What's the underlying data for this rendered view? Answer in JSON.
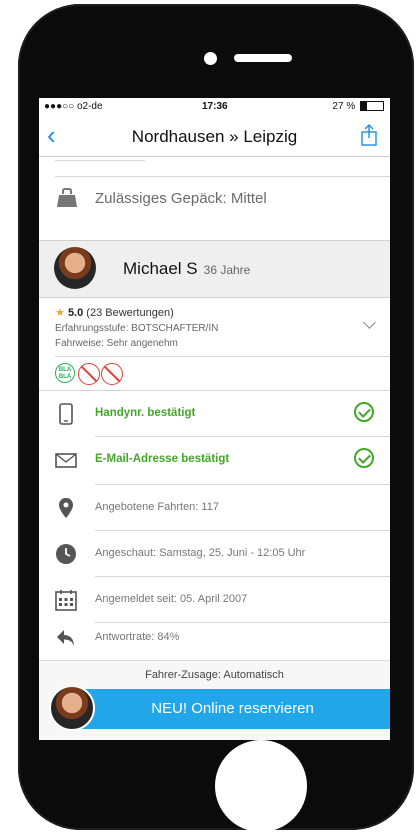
{
  "status_bar": {
    "carrier": "●●●○○ o2-de",
    "time": "17:36",
    "battery": "27 %"
  },
  "nav": {
    "title": "Nordhausen » Leipzig",
    "back_icon": "chevron-left-icon",
    "share_icon": "share-icon"
  },
  "luggage": {
    "label": "Zulässiges Gepäck: Mittel"
  },
  "driver": {
    "name": "Michael S",
    "age": "36 Jahre",
    "rating_score": "5.0",
    "rating_count": "(23 Bewertungen)",
    "experience": "Erfahrungsstufe: BOTSCHAFTER/IN",
    "driving_style": "Fahrweise: Sehr angenehm",
    "prefs_badge": "BLA BLA"
  },
  "verifications": [
    {
      "label": "Handynr. bestätigt",
      "icon": "phone-icon"
    },
    {
      "label": "E-Mail-Adresse bestätigt",
      "icon": "mail-icon"
    }
  ],
  "stats": [
    {
      "label": "Angebotene Fahrten: 117",
      "icon": "location-pin-icon"
    },
    {
      "label": "Angeschaut: Samstag, 25. Juni - 12:05 Uhr",
      "icon": "clock-icon"
    },
    {
      "label": "Angemeldet seit: 05. April 2007",
      "icon": "calendar-icon"
    },
    {
      "label": "Antwortrate: 84%",
      "icon": "reply-icon"
    }
  ],
  "footer": {
    "mode": "Fahrer-Zusage: Automatisch",
    "book_label": "NEU! Online reservieren"
  },
  "colors": {
    "accent": "#21a6ea",
    "ok": "#43a829",
    "star": "#f5a623",
    "no": "#e0403a"
  }
}
